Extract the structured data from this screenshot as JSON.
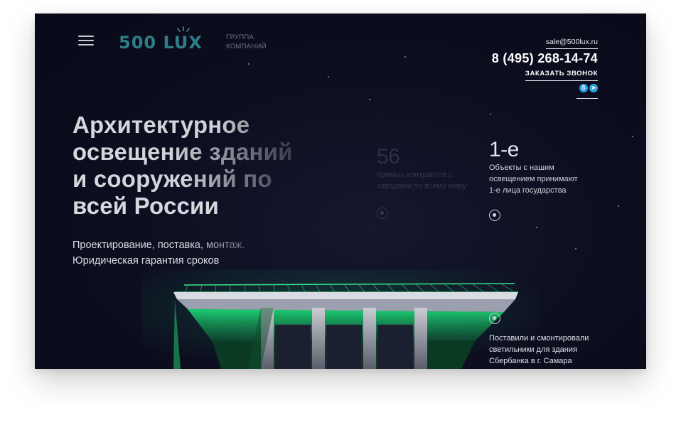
{
  "header": {
    "menu_icon": "hamburger-menu-icon",
    "logo": {
      "text": "500 LUX",
      "color": "#2f7e86"
    },
    "logo_sub": [
      "ГРУППА",
      "КОМПАНИЙ"
    ],
    "email": "sale@500lux.ru",
    "phone": "8 (495) 268-14-74",
    "callback": "ЗАКАЗАТЬ ЗВОНОК",
    "messengers": [
      {
        "icon": "skype-icon",
        "glyph": "S"
      },
      {
        "icon": "telegram-icon",
        "glyph": "➤"
      }
    ]
  },
  "hero": {
    "headline": [
      "Архитектурное",
      "освещение зданий",
      "и сооружений по",
      "всей России"
    ],
    "subline": [
      "Проектирование, поставка, монтаж.",
      "Юридическая гарантия сроков"
    ]
  },
  "stats": [
    {
      "value": "56",
      "description": [
        "прямых контрактов с",
        "заводами по всему миру"
      ]
    },
    {
      "value": "1-е",
      "description": [
        "Объекты с нашим",
        "освещением принимают",
        "1-е лица государства"
      ]
    }
  ],
  "project_note": [
    "Поставили и смонтировали",
    "светильники для здания",
    "Сбербанка в г. Самара"
  ],
  "colors": {
    "background": "#0c0e1f",
    "accent_green": "#1ee07a",
    "text_light": "#d6d8de"
  }
}
